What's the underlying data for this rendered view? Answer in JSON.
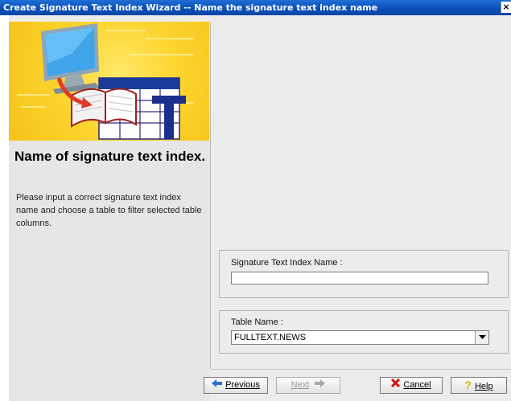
{
  "window": {
    "title": "Create Signature Text Index Wizard -- Name the signature text index name",
    "close_glyph": "×"
  },
  "left": {
    "heading": "Name of signature text index.",
    "description": "Please input a correct signature text index name and choose a table to filter selected table columns."
  },
  "form": {
    "index_name_label": "Signature Text Index Name :",
    "index_name_value": "",
    "table_name_label": "Table Name :",
    "table_name_value": "FULLTEXT.NEWS"
  },
  "buttons": {
    "previous": "Previous",
    "next": "Next",
    "cancel": "Cancel",
    "help": "Help"
  },
  "icons": {
    "previous": "arrow-left-icon",
    "next": "arrow-right-icon",
    "cancel": "x-icon",
    "help": "question-icon",
    "dropdown": "chevron-down-icon",
    "banner": "computer-book-table-icon"
  },
  "colors": {
    "titlebar": "#0B4FB8",
    "banner": "#FCD52F",
    "cancel_icon": "#D01818",
    "help_icon": "#E0B000",
    "nav_arrow": "#2D6FD1"
  }
}
